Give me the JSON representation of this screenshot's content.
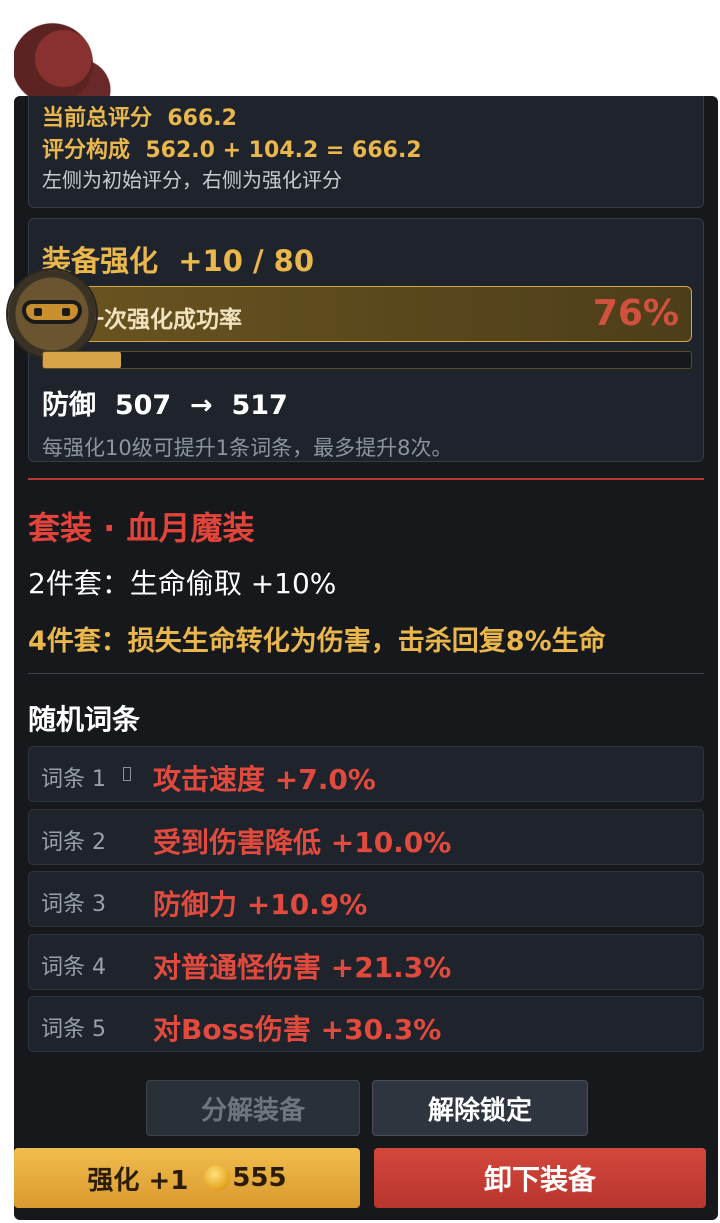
{
  "score": {
    "total_label": "当前总评分",
    "total_value": "666.2",
    "composition_label": "评分构成",
    "composition_value": "562.0 + 104.2 = 666.2",
    "note": "左侧为初始评分，右侧为强化评分"
  },
  "enhance": {
    "title": "装备强化",
    "level_text": "+10 / 80",
    "rate_label": "一次强化成功率",
    "rate_value": "76%",
    "progress_fraction": 0.12,
    "stat_label": "防御",
    "stat_from": "507",
    "arrow": "→",
    "stat_to": "517",
    "note": "每强化10级可提升1条词条，最多提升8次。"
  },
  "set": {
    "title": "套装 · 血月魔装",
    "bonus_2": "2件套：生命偷取 +10%",
    "bonus_4": "4件套：损失生命转化为伤害，击杀回复8%生命"
  },
  "affixes": {
    "title": "随机词条",
    "items": [
      {
        "label": "词条 1",
        "value": "攻击速度 +7.0%"
      },
      {
        "label": "词条 2",
        "value": "受到伤害降低 +10.0%"
      },
      {
        "label": "词条 3",
        "value": "防御力 +10.9%"
      },
      {
        "label": "词条 4",
        "value": "对普通怪伤害 +21.3%"
      },
      {
        "label": "词条 5",
        "value": "对Boss伤害 +30.3%"
      }
    ]
  },
  "buttons": {
    "decompose": "分解装备",
    "unlock": "解除锁定",
    "enhance": "强化 +1",
    "enhance_cost": "555",
    "unequip": "卸下装备"
  },
  "colors": {
    "panel_bg": "#16181c",
    "gold": "#e9b74c",
    "red": "#e0443a",
    "enhance_button": "#e5aa3c",
    "unequip_button": "#c63f35"
  },
  "icons": {
    "rate_icon": "goggles-icon",
    "coin": "gold-coin-icon",
    "ornament": "red-dragon-ornament",
    "affix_1_tag": "lock-icon"
  }
}
